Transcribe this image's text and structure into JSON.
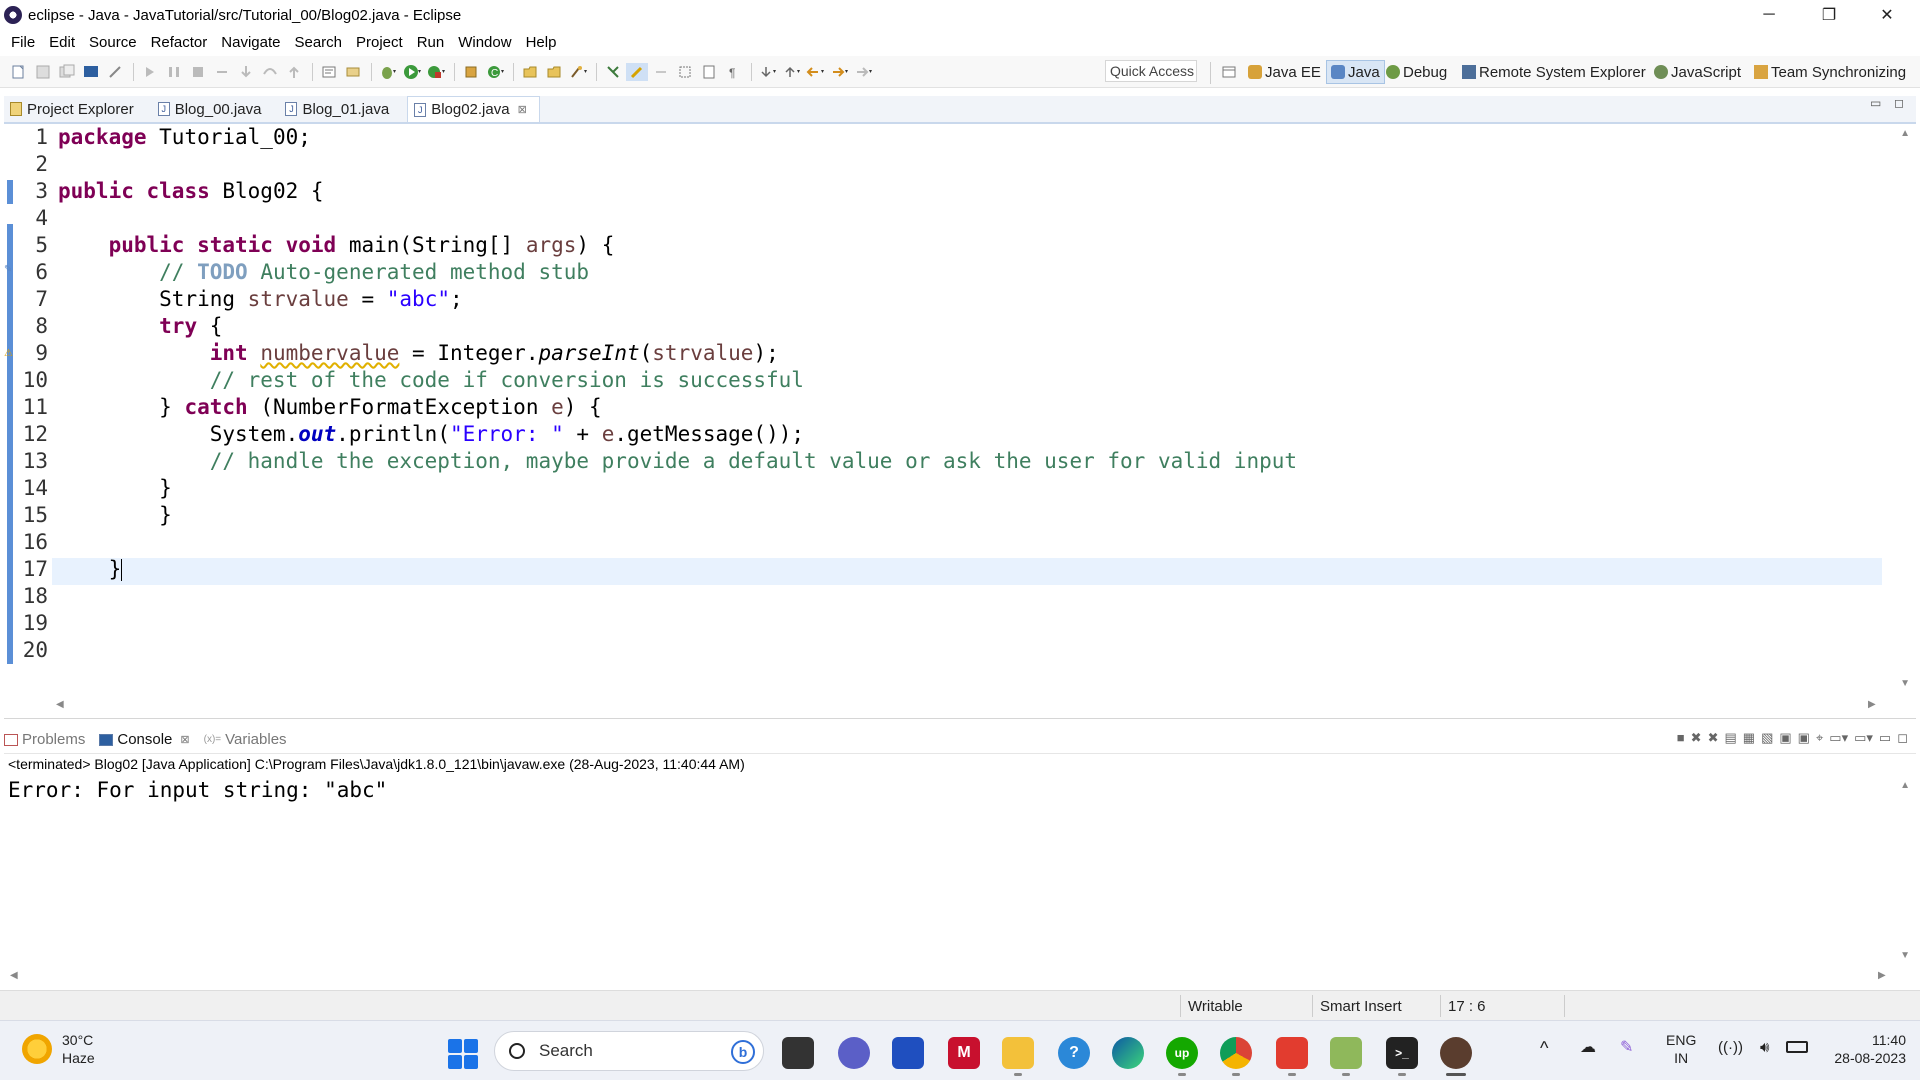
{
  "window": {
    "title": "eclipse - Java - JavaTutorial/src/Tutorial_00/Blog02.java - Eclipse",
    "controls": [
      "─",
      "❐",
      "✕"
    ]
  },
  "menu": {
    "items": [
      "File",
      "Edit",
      "Source",
      "Refactor",
      "Navigate",
      "Search",
      "Project",
      "Run",
      "Window",
      "Help"
    ]
  },
  "toolbar": {
    "quick_access": "Quick Access",
    "perspectives": [
      "Java EE",
      "Java",
      "Debug",
      "Remote System Explorer",
      "JavaScript",
      "Team Synchronizing"
    ],
    "active_perspective": "Java"
  },
  "editor_tabs": {
    "items": [
      {
        "label": "Project Explorer"
      },
      {
        "label": "Blog_00.java"
      },
      {
        "label": "Blog_01.java"
      },
      {
        "label": "Blog02.java"
      }
    ],
    "active": "Blog02.java",
    "close_glyph": "⊠"
  },
  "code": {
    "line_numbers": [
      "1",
      "2",
      "3",
      "4",
      "5",
      "6",
      "7",
      "8",
      "9",
      "10",
      "11",
      "12",
      "13",
      "14",
      "15",
      "16",
      "17",
      "18",
      "19",
      "20"
    ],
    "l1": {
      "kw": "package",
      "rest": " Tutorial_00;"
    },
    "l3": {
      "kw1": "public",
      "kw2": "class",
      "rest": " Blog02 {"
    },
    "l5": {
      "kw1": "public",
      "kw2": "static",
      "kw3": "void",
      "rest": " main(String[] ",
      "arg": "args",
      "end": ") {"
    },
    "l6": {
      "c1": "// ",
      "todo": "TODO",
      "c2": " Auto-generated method stub"
    },
    "l7": {
      "t": "String ",
      "v": "strvalue",
      "eq": " = ",
      "s": "\"abc\"",
      "end": ";"
    },
    "l8": {
      "kw": "try",
      "rest": " {"
    },
    "l9": {
      "kw": "int",
      "sp": " ",
      "v": "numbervalue",
      "a": " = Integer.",
      "m": "parseInt",
      "b": "(",
      "v2": "strvalue",
      "end": ");"
    },
    "l10": {
      "c": "// rest of the code if conversion is successful"
    },
    "l11": {
      "a": "} ",
      "kw": "catch",
      "b": " (NumberFormatException ",
      "v": "e",
      "end": ") {"
    },
    "l12": {
      "a": "System.",
      "f": "out",
      "b": ".println(",
      "s": "\"Error: \"",
      "c": " + ",
      "v": "e",
      "end": ".getMessage());"
    },
    "l13": {
      "c": "// handle the exception, maybe provide a default value or ask the user for valid input"
    },
    "l14": "}",
    "l15": "}",
    "l17": "}"
  },
  "console": {
    "tabs": [
      "Problems",
      "Console",
      "Variables"
    ],
    "active_tab": "Console",
    "header": "<terminated> Blog02 [Java Application] C:\\Program Files\\Java\\jdk1.8.0_121\\bin\\javaw.exe (28-Aug-2023, 11:40:44 AM)",
    "output": "Error: For input string: \"abc\""
  },
  "status": {
    "writable": "Writable",
    "insert_mode": "Smart Insert",
    "position": "17 : 6"
  },
  "taskbar": {
    "weather_temp": "30°C",
    "weather_desc": "Haze",
    "search_placeholder": "Search",
    "bing_glyph": "b",
    "language": "ENG",
    "region": "IN",
    "time": "11:40",
    "date": "28-08-2023"
  },
  "colors": {
    "keyword": "#7f0055",
    "comment": "#3f7f5f",
    "string": "#2a00ff",
    "field": "#0000c0",
    "current_line": "#e8f2fe"
  }
}
